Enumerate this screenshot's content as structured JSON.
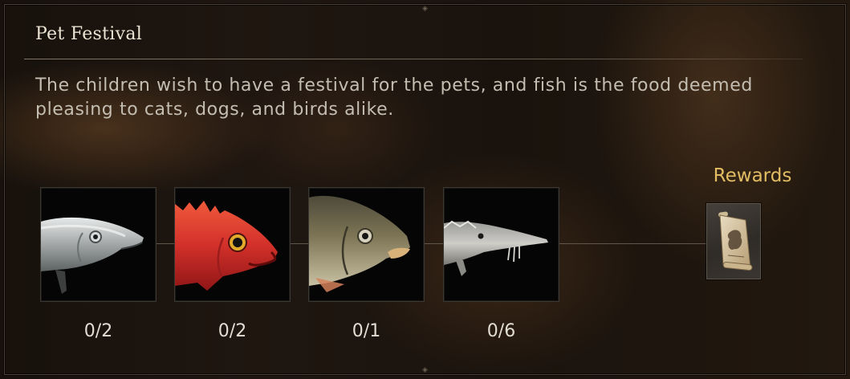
{
  "quest": {
    "title": "Pet Festival",
    "description": "The children wish to have a festival for the pets, and fish is the food deemed pleasing to cats, dogs, and birds alike."
  },
  "requirements": [
    {
      "icon": "silver-fish-icon",
      "progress": "0/2"
    },
    {
      "icon": "red-fish-icon",
      "progress": "0/2"
    },
    {
      "icon": "bronze-fish-icon",
      "progress": "0/1"
    },
    {
      "icon": "sturgeon-icon",
      "progress": "0/6"
    }
  ],
  "rewards": {
    "label": "Rewards",
    "items": [
      {
        "icon": "treasure-map-scroll-icon"
      }
    ]
  },
  "colors": {
    "title": "#ebe3d3",
    "description": "#c4bdb1",
    "rewards_label": "#e3bd63",
    "count": "#e2ddd3"
  }
}
